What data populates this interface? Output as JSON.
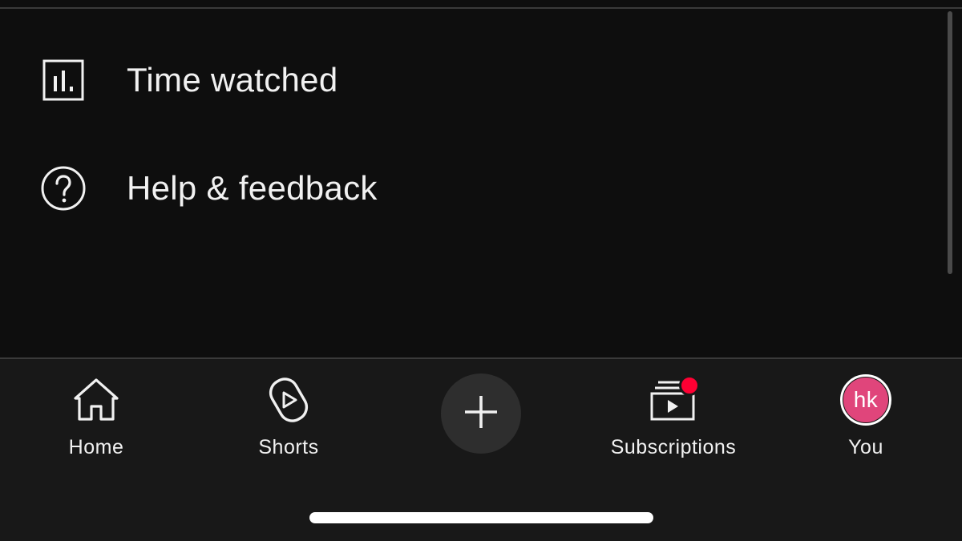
{
  "menu": {
    "items": [
      {
        "label": "Time watched",
        "icon": "bar-chart-icon"
      },
      {
        "label": "Help & feedback",
        "icon": "help-circle-icon"
      }
    ]
  },
  "bottom_nav": {
    "tabs": [
      {
        "label": "Home",
        "icon": "home-icon"
      },
      {
        "label": "Shorts",
        "icon": "shorts-icon"
      },
      {
        "label": "Subscriptions",
        "icon": "subscriptions-icon",
        "has_notification_dot": true
      },
      {
        "label": "You",
        "icon": "avatar"
      }
    ],
    "create_icon": "plus-icon",
    "avatar_initials": "hk"
  },
  "colors": {
    "background": "#0e0e0e",
    "nav_background": "#181818",
    "notification": "#ff0033",
    "avatar": "#e0457b",
    "create_button": "#2e2e2e"
  }
}
